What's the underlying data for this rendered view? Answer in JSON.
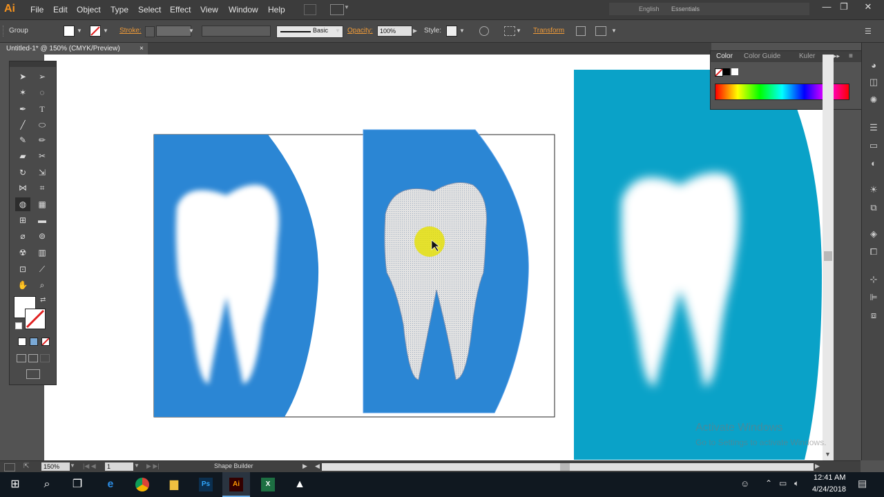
{
  "app": {
    "logo": "Ai"
  },
  "menu": [
    "File",
    "Edit",
    "Object",
    "Type",
    "Select",
    "Effect",
    "View",
    "Window",
    "Help"
  ],
  "top_right": {
    "language": "English",
    "workspace": "Essentials"
  },
  "window_controls": {
    "minimize": "—",
    "restore": "❐",
    "close": "✕"
  },
  "control_bar": {
    "selection_type": "Group",
    "stroke_label": "Stroke:",
    "stroke_profile": "Basic",
    "opacity_label": "Opacity:",
    "opacity_value": "100%",
    "style_label": "Style:",
    "transform_label": "Transform"
  },
  "document_tab": {
    "title": "Untitled-1* @ 150% (CMYK/Preview)",
    "close": "×"
  },
  "color_panel": {
    "tabs": [
      "Color",
      "Color Guide",
      "Kuler"
    ]
  },
  "status_bar": {
    "zoom": "150%",
    "artboard": "1",
    "tool": "Shape Builder"
  },
  "watermark": {
    "title": "Activate Windows",
    "subtitle": "Go to Settings to activate Windows."
  },
  "taskbar": {
    "time": "12:41 AM",
    "date": "4/24/2018"
  },
  "colors": {
    "tooth_blue": "#2b86d4",
    "teal": "#0aa2c8",
    "accent": "#f29c38",
    "highlight": "#e6e100"
  }
}
